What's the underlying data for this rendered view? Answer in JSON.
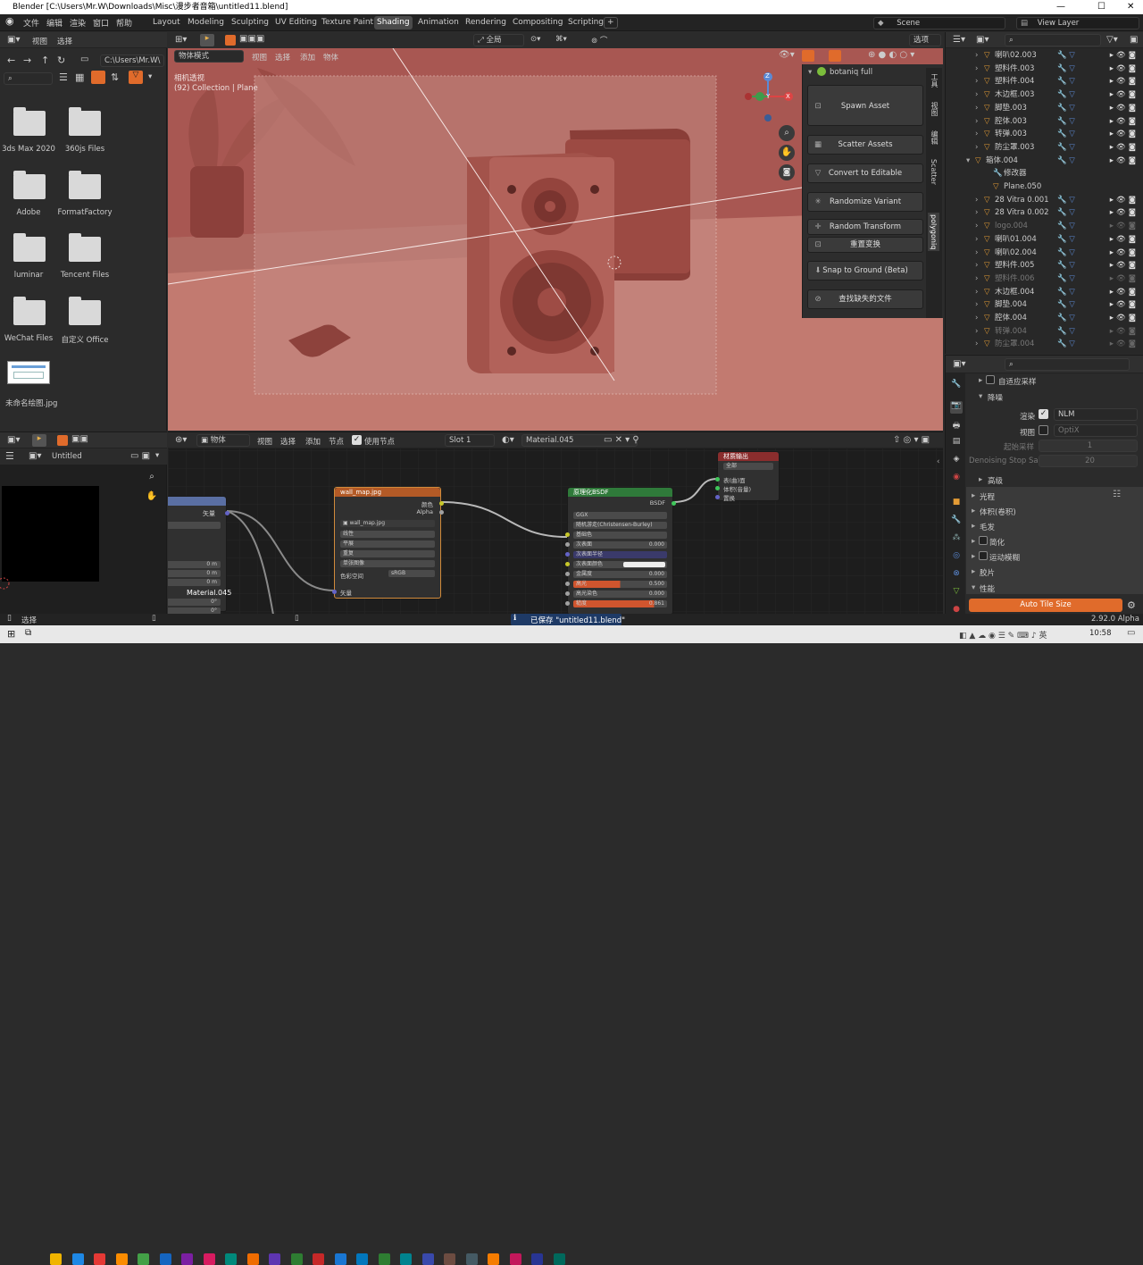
{
  "title": "Blender [C:\\Users\\Mr.W\\Downloads\\Misc\\漫步者音箱\\untitled11.blend]",
  "window_controls": {
    "minimize": "—",
    "maximize": "☐",
    "close": "✕"
  },
  "menu": [
    "文件",
    "编辑",
    "渲染",
    "窗口",
    "帮助"
  ],
  "workspaces": [
    "Layout",
    "Modeling",
    "Sculpting",
    "UV Editing",
    "Texture Paint",
    "Shading",
    "Animation",
    "Rendering",
    "Compositing",
    "Scripting"
  ],
  "add_workspace": "+",
  "scene": "Scene",
  "view_layer": "View Layer",
  "file_browser": {
    "menu_view": "视图",
    "menu_select": "选择",
    "path": "C:\\Users\\Mr.W\\",
    "folders": [
      "3ds Max 2020",
      "360js Files",
      "Adobe",
      "FormatFactory",
      "luminar",
      "Tencent Files",
      "WeChat Files",
      "自定义 Office"
    ],
    "image_file": "未命名绘图.jpg"
  },
  "viewport": {
    "mode": "物体模式",
    "menu": [
      "视图",
      "选择",
      "添加",
      "物体"
    ],
    "camera_title": "相机透视",
    "collection": "(92) Collection | Plane",
    "orientation": "全局",
    "options": "选项",
    "gizmo": {
      "z": "Z",
      "y": "Y",
      "x": "X"
    }
  },
  "npanel": {
    "title": "botaniq full",
    "buttons": [
      "Spawn Asset",
      "Scatter Assets",
      "Convert to Editable",
      "Randomize Variant",
      "Random Transform",
      "重置变换",
      "Snap to Ground (Beta)",
      "查找缺失的文件"
    ],
    "tabs": [
      "工具",
      "视图",
      "编辑",
      "Scatter",
      "polygoniq"
    ]
  },
  "outliner": {
    "rows": [
      {
        "name": "喇叭02.003",
        "indent": 1,
        "dim": false
      },
      {
        "name": "塑料件.003",
        "indent": 1,
        "dim": false
      },
      {
        "name": "塑料件.004",
        "indent": 1,
        "dim": false
      },
      {
        "name": "木边框.003",
        "indent": 1,
        "dim": false
      },
      {
        "name": "脚垫.003",
        "indent": 1,
        "dim": false
      },
      {
        "name": "腔体.003",
        "indent": 1,
        "dim": false
      },
      {
        "name": "转弹.003",
        "indent": 1,
        "dim": false
      },
      {
        "name": "防尘罩.003",
        "indent": 1,
        "dim": false
      },
      {
        "name": "箱体.004",
        "indent": 0,
        "dim": false
      },
      {
        "name": "修改器",
        "indent": 2,
        "dim": false
      },
      {
        "name": "Plane.050",
        "indent": 2,
        "dim": false
      },
      {
        "name": "28 Vitra 0.001",
        "indent": 1,
        "dim": false
      },
      {
        "name": "28 Vitra 0.002",
        "indent": 1,
        "dim": false
      },
      {
        "name": "logo.004",
        "indent": 1,
        "dim": true
      },
      {
        "name": "喇叭01.004",
        "indent": 1,
        "dim": false
      },
      {
        "name": "喇叭02.004",
        "indent": 1,
        "dim": false
      },
      {
        "name": "塑料件.005",
        "indent": 1,
        "dim": false
      },
      {
        "name": "塑料件.006",
        "indent": 1,
        "dim": true
      },
      {
        "name": "木边框.004",
        "indent": 1,
        "dim": false
      },
      {
        "name": "脚垫.004",
        "indent": 1,
        "dim": false
      },
      {
        "name": "腔体.004",
        "indent": 1,
        "dim": false
      },
      {
        "name": "转弹.004",
        "indent": 1,
        "dim": true
      },
      {
        "name": "防尘罩.004",
        "indent": 1,
        "dim": true
      }
    ]
  },
  "properties": {
    "adaptive_sampling": "自适应采样",
    "denoise": "降噪",
    "render_label": "渲染",
    "render_value": "NLM",
    "viewport_label": "视图",
    "viewport_value": "OptiX",
    "start_sample_label": "起始采样",
    "start_sample_value": "1",
    "denoise_stop_label": "Denoising Stop Sa...",
    "denoise_stop_value": "20",
    "advanced": "高级",
    "sections": [
      "光程",
      "体积(卷积)",
      "毛发",
      "简化",
      "运动模糊",
      "胶片",
      "性能"
    ],
    "auto_tile": "Auto Tile Size"
  },
  "node_editor": {
    "object": "物体",
    "menu": [
      "视图",
      "选择",
      "添加",
      "节点"
    ],
    "use_nodes": "使用节点",
    "slot": "Slot 1",
    "material": "Material.045",
    "image_node": {
      "title": "wall_map.jpg",
      "out_color": "颜色",
      "out_alpha": "Alpha",
      "image": "wall_map.jpg",
      "interp": "线性",
      "proj": "平展",
      "ext": "重复",
      "src": "单张图像",
      "colorspace_label": "色彩空间",
      "colorspace": "sRGB",
      "in_vector": "矢量"
    },
    "bsdf_node": {
      "title": "原理化BSDF",
      "out": "BSDF",
      "dist": "GGX",
      "sss": "随机游走(Christensen-Burley)",
      "rows": [
        {
          "label": "基础色",
          "value": ""
        },
        {
          "label": "次表面",
          "value": "0.000"
        },
        {
          "label": "次表面半径",
          "value": ""
        },
        {
          "label": "次表面颜色",
          "value": ""
        },
        {
          "label": "金属度",
          "value": "0.000"
        },
        {
          "label": "高光",
          "value": "0.500"
        },
        {
          "label": "高光染色",
          "value": "0.000"
        },
        {
          "label": "糙度",
          "value": "0.861"
        }
      ]
    },
    "output_node": {
      "title": "材质输出",
      "target": "全部",
      "inputs": [
        "表(曲)面",
        "体积(音量)",
        "置换"
      ]
    },
    "left_node": {
      "out": "矢量",
      "vals": [
        "0 m",
        "0 m",
        "0 m"
      ],
      "material": "Material.045",
      "rot": [
        "0°",
        "0°"
      ]
    }
  },
  "image_editor": {
    "name": "Untitled"
  },
  "statusbar": {
    "select": "选择",
    "saved": "已保存 \"untitled11.blend\"",
    "version": "2.92.0 Alpha"
  },
  "taskbar": {
    "time": "10:58"
  }
}
